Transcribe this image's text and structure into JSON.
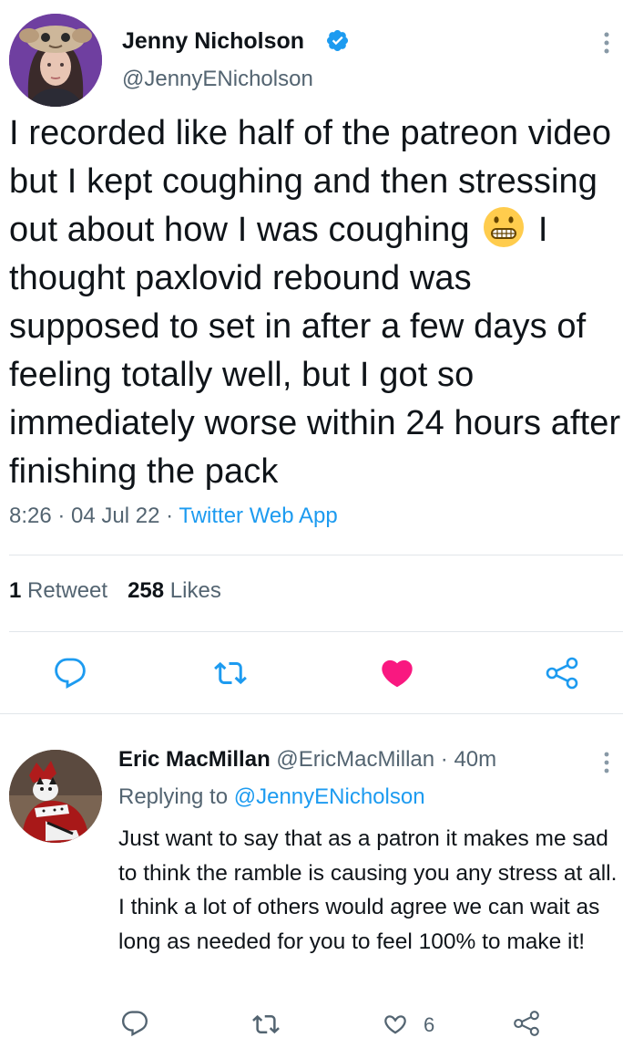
{
  "main_tweet": {
    "author_name": "Jenny Nicholson",
    "author_handle": "@JennyENicholson",
    "text_part1": "I recorded like half of the patreon video but I kept coughing and then stressing out about how I was coughing",
    "emoji_name": "grimacing-face-emoji",
    "text_part2": "I thought paxlovid rebound was supposed to set in after a few days of feeling totally well, but I got so immediately worse within 24 hours after finishing the pack",
    "time": "8:26",
    "date": "04 Jul 22",
    "source": "Twitter Web App",
    "separator": " · ",
    "retweet_count": "1",
    "retweet_label": "Retweet",
    "like_count": "258",
    "like_label": "Likes",
    "liked": true,
    "actions": [
      "reply-icon",
      "retweet-icon",
      "like-icon",
      "share-icon"
    ]
  },
  "reply_tweet": {
    "author_name": "Eric MacMillan",
    "author_handle": "@EricMacMillan",
    "time_ago": "40m",
    "replying_to_label": "Replying to",
    "replying_to_handle": "@JennyENicholson",
    "text": "Just want to say that as a patron it makes me sad to think the ramble is causing you any stress at all.  I think a lot of others would agree we can wait as long as needed for you to feel 100% to make it!",
    "like_count": "6",
    "actions": [
      "reply-icon",
      "retweet-icon",
      "like-icon",
      "share-icon"
    ]
  },
  "colors": {
    "accent_blue": "#1d9bf0",
    "like_pink": "#f91880",
    "secondary_text": "#536471",
    "primary_text": "#0f1419"
  }
}
